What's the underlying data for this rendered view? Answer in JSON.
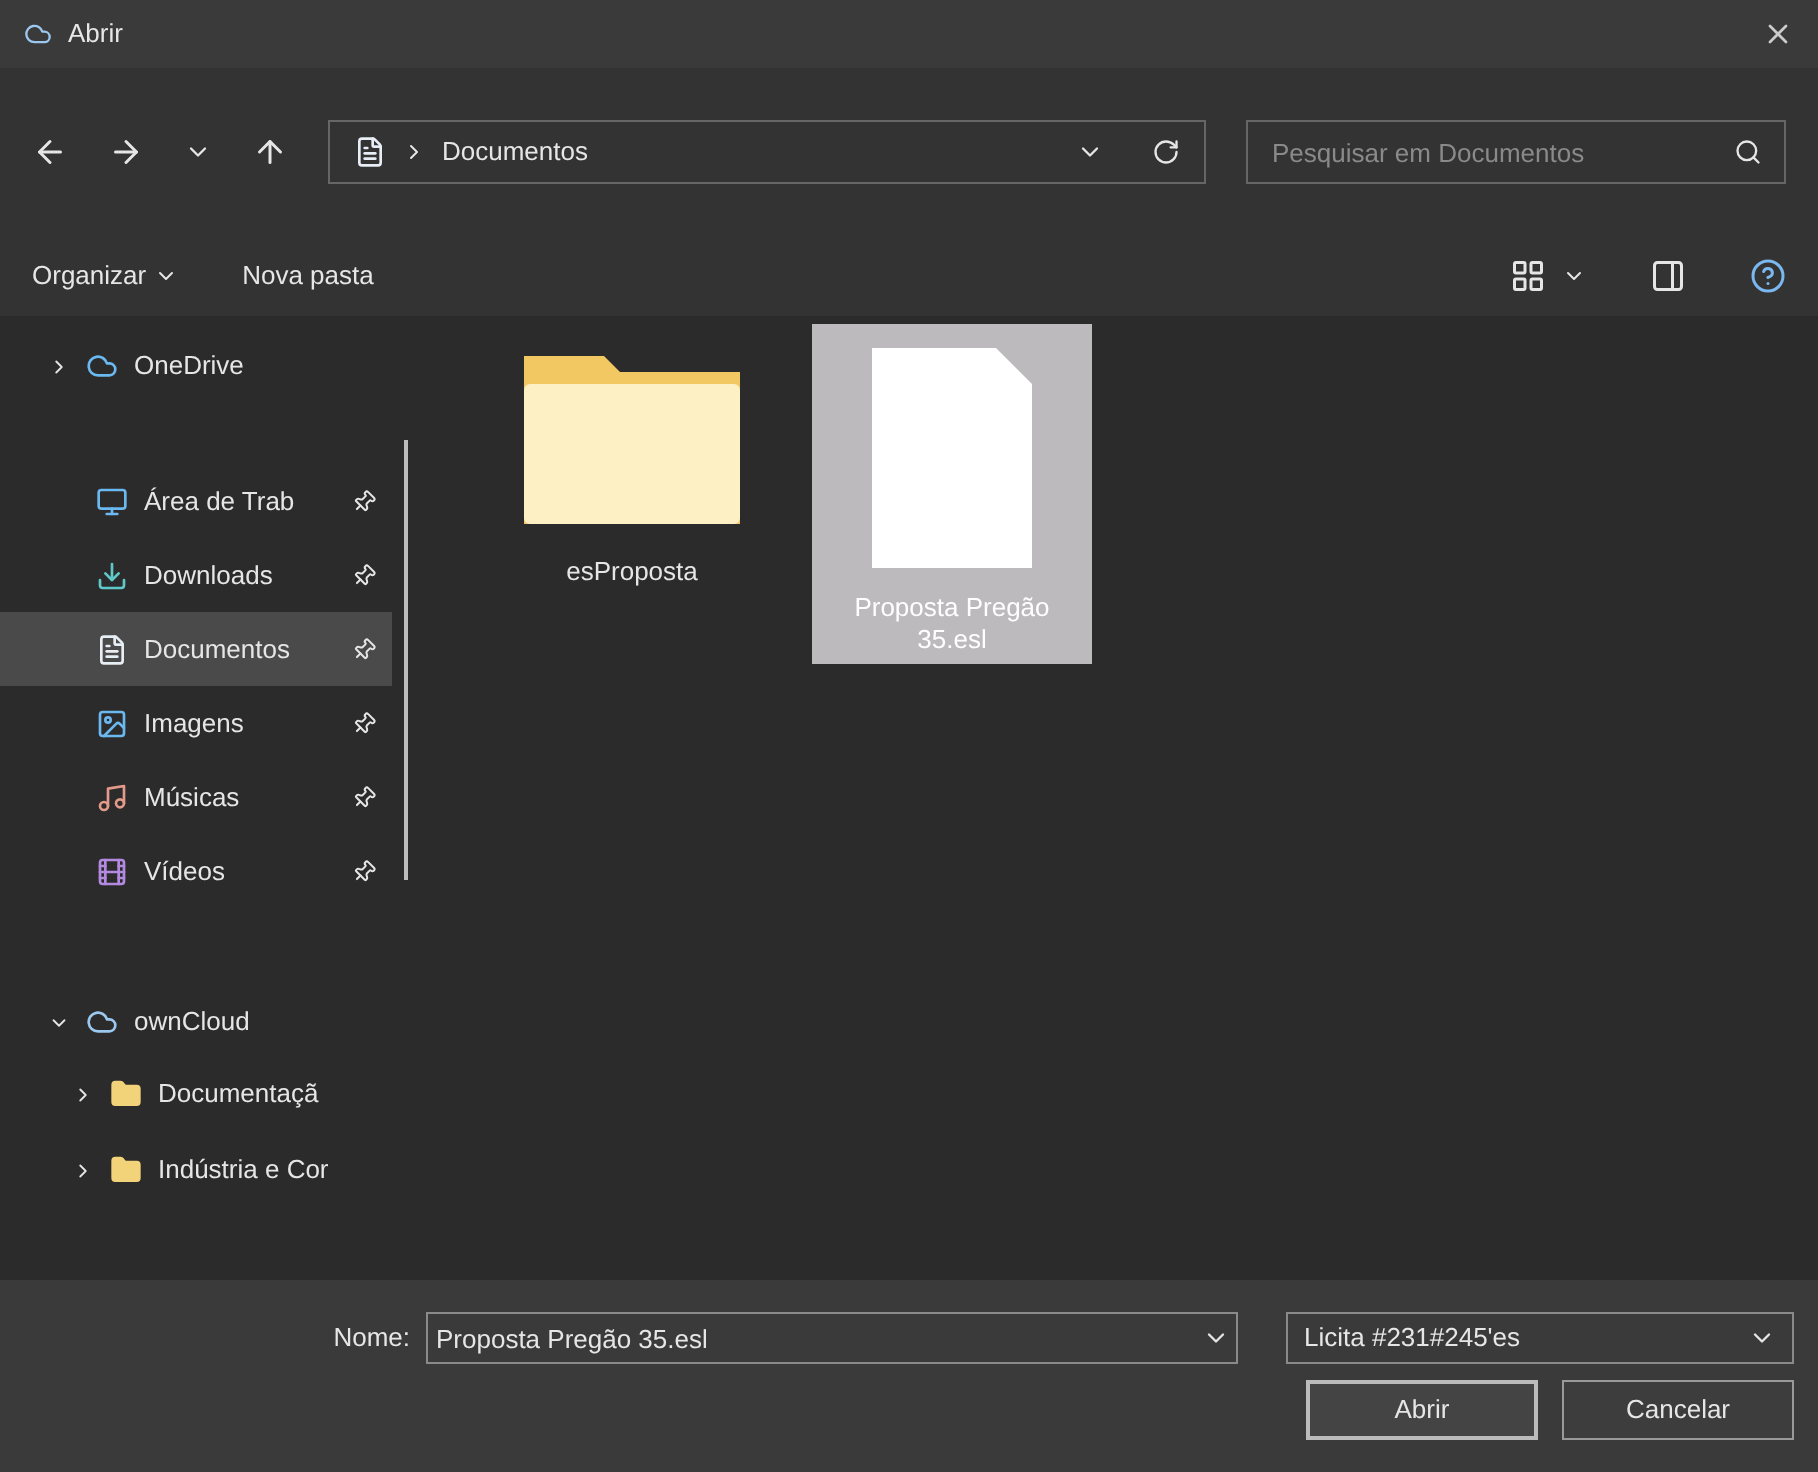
{
  "window": {
    "title": "Abrir"
  },
  "navigation": {
    "path": "Documentos",
    "search": {
      "placeholder": "Pesquisar em Documentos"
    }
  },
  "toolbar": {
    "organize": "Organizar",
    "new_folder": "Nova pasta"
  },
  "sidebar": {
    "onedrive": {
      "label": "OneDrive",
      "expanded": false
    },
    "quick_access": [
      {
        "kind": "desktop",
        "label": "Área de Trab",
        "pinned": true,
        "selected": false
      },
      {
        "kind": "downloads",
        "label": "Downloads",
        "pinned": true,
        "selected": false
      },
      {
        "kind": "documents",
        "label": "Documentos",
        "pinned": true,
        "selected": true
      },
      {
        "kind": "pictures",
        "label": "Imagens",
        "pinned": true,
        "selected": false
      },
      {
        "kind": "music",
        "label": "Músicas",
        "pinned": true,
        "selected": false
      },
      {
        "kind": "videos",
        "label": "Vídeos",
        "pinned": true,
        "selected": false
      }
    ],
    "owncloud": {
      "label": "ownCloud",
      "expanded": true,
      "children": [
        {
          "label": "Documentaçã",
          "expanded": false
        },
        {
          "label": "Indústria e Cor",
          "expanded": false
        }
      ]
    }
  },
  "files": [
    {
      "kind": "folder",
      "name": "esProposta",
      "selected": false
    },
    {
      "kind": "file",
      "name": "Proposta Pregão 35.esl",
      "selected": true
    }
  ],
  "footer": {
    "name_label": "Nome:",
    "name_value": "Proposta Pregão 35.esl",
    "filter": "Licita #231#245'es",
    "buttons": [
      {
        "kind": "primary",
        "label": "Abrir"
      },
      {
        "kind": "secondary",
        "label": "Cancelar"
      }
    ]
  }
}
